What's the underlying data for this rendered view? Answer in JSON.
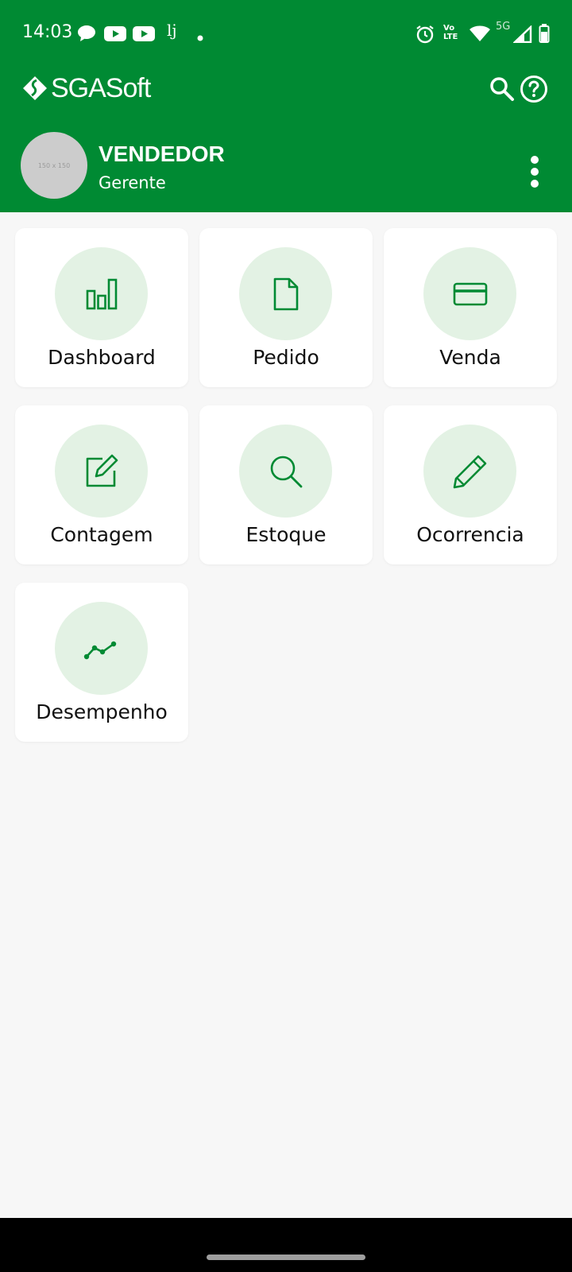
{
  "status_bar": {
    "time": "14:03",
    "left_icons": [
      "chat-bubble-icon",
      "youtube-icon",
      "youtube-icon",
      "app-lj-icon",
      "notification-dot-icon"
    ],
    "right_icons": [
      "alarm-icon",
      "volte-icon",
      "wifi-icon",
      "5g-icon",
      "signal-icon",
      "battery-icon"
    ],
    "volte_top": "Vo",
    "volte_bottom": "LTE",
    "network_label": "5G",
    "lj_label": "lj"
  },
  "app_bar": {
    "logo_text": "SGASoft",
    "actions": [
      "search-icon",
      "help-icon"
    ]
  },
  "profile": {
    "avatar_placeholder": "150 x 150",
    "name": "VENDEDOR",
    "role": "Gerente"
  },
  "menu": {
    "items": [
      {
        "label": "Dashboard",
        "icon": "bar-chart-icon"
      },
      {
        "label": "Pedido",
        "icon": "document-icon"
      },
      {
        "label": "Venda",
        "icon": "credit-card-icon"
      },
      {
        "label": "Contagem",
        "icon": "edit-square-icon"
      },
      {
        "label": "Estoque",
        "icon": "search-icon"
      },
      {
        "label": "Ocorrencia",
        "icon": "pencil-icon"
      },
      {
        "label": "Desempenho",
        "icon": "line-trend-icon"
      }
    ]
  },
  "colors": {
    "primary": "#008a33",
    "icon_circle": "#e3f2e4",
    "background": "#f7f7f7"
  }
}
